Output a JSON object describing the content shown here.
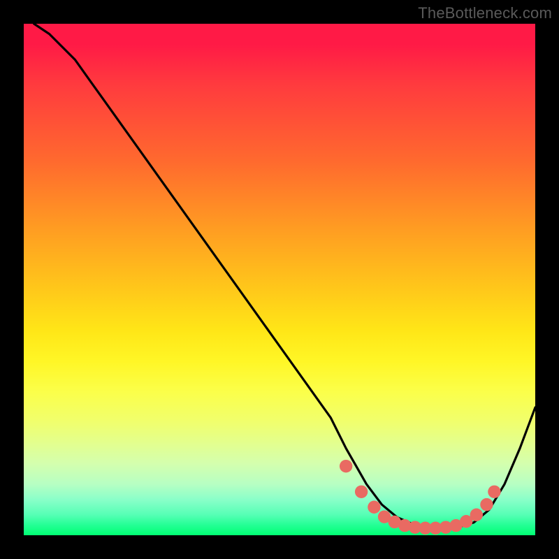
{
  "watermark": "TheBottleneck.com",
  "chart_data": {
    "type": "line",
    "title": "",
    "xlabel": "",
    "ylabel": "",
    "xlim": [
      0,
      100
    ],
    "ylim": [
      0,
      100
    ],
    "series": [
      {
        "name": "bottleneck-curve",
        "x": [
          2,
          5,
          10,
          15,
          20,
          25,
          30,
          35,
          40,
          45,
          50,
          55,
          60,
          63,
          67,
          70,
          73,
          76,
          79,
          82,
          85,
          88,
          91,
          94,
          97,
          100
        ],
        "values": [
          100,
          98,
          93,
          86,
          79,
          72,
          65,
          58,
          51,
          44,
          37,
          30,
          23,
          17,
          10,
          6,
          3.5,
          2.2,
          1.6,
          1.4,
          1.6,
          2.5,
          5,
          10,
          17,
          25
        ]
      }
    ],
    "markers": {
      "name": "highlighted-points",
      "color": "#e96a62",
      "x": [
        63,
        66,
        68.5,
        70.5,
        72.5,
        74.5,
        76.5,
        78.5,
        80.5,
        82.5,
        84.5,
        86.5,
        88.5,
        90.5,
        92
      ],
      "values": [
        13.5,
        8.5,
        5.5,
        3.6,
        2.6,
        1.9,
        1.55,
        1.4,
        1.4,
        1.55,
        1.9,
        2.7,
        4.0,
        6.0,
        8.5
      ]
    },
    "background": "rainbow-gradient-red-to-green"
  }
}
